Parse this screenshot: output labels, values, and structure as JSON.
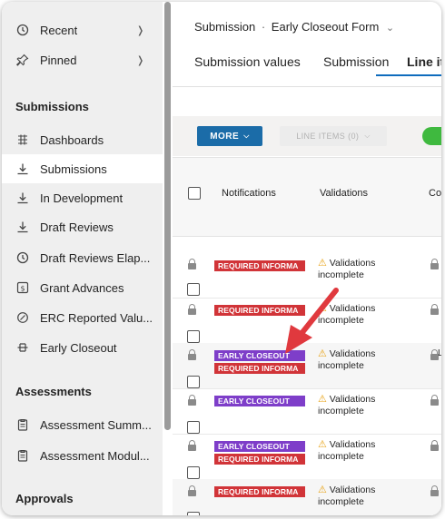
{
  "sidebar": {
    "top_items": [
      {
        "label": "Recent",
        "icon": "clock-icon"
      },
      {
        "label": "Pinned",
        "icon": "pin-icon"
      }
    ],
    "sections": [
      {
        "title": "Submissions",
        "items": [
          {
            "label": "Dashboards",
            "icon": "dashboard-icon"
          },
          {
            "label": "Submissions",
            "icon": "download-icon"
          },
          {
            "label": "In Development",
            "icon": "download-icon"
          },
          {
            "label": "Draft Reviews",
            "icon": "download-icon"
          },
          {
            "label": "Draft Reviews Elap...",
            "icon": "clock-icon"
          },
          {
            "label": "Grant Advances",
            "icon": "money-icon"
          },
          {
            "label": "ERC Reported Valu...",
            "icon": "link-icon"
          },
          {
            "label": "Early Closeout",
            "icon": "closeout-icon"
          }
        ]
      },
      {
        "title": "Assessments",
        "items": [
          {
            "label": "Assessment Summ...",
            "icon": "clipboard-icon"
          },
          {
            "label": "Assessment Modul...",
            "icon": "clipboard-icon"
          }
        ]
      },
      {
        "title": "Approvals",
        "items": []
      }
    ]
  },
  "header": {
    "breadcrumb": [
      "Submission",
      "Early Closeout Form"
    ]
  },
  "tabs": [
    {
      "label": "Submission values"
    },
    {
      "label": "Submission"
    },
    {
      "label": "Line it"
    }
  ],
  "toolbar": {
    "more_label": "MORE",
    "line_items_label": "LINE ITEMS (0)"
  },
  "grid": {
    "columns": [
      "Notifications",
      "Validations",
      "Cor"
    ],
    "rows": [
      {
        "badges": [
          {
            "text": "REQUIRED INFORMA",
            "color": "red"
          }
        ],
        "validation": [
          "Validations",
          "incomplete"
        ],
        "extra": ""
      },
      {
        "badges": [
          {
            "text": "REQUIRED INFORMA",
            "color": "red"
          }
        ],
        "validation": [
          "Validations",
          "incomplete"
        ],
        "extra": ""
      },
      {
        "badges": [
          {
            "text": "EARLY CLOSEOUT",
            "color": "purple"
          },
          {
            "text": "REQUIRED INFORMA",
            "color": "red"
          }
        ],
        "validation": [
          "Validations",
          "incomplete"
        ],
        "extra": "Le"
      },
      {
        "badges": [
          {
            "text": "EARLY CLOSEOUT",
            "color": "purple"
          }
        ],
        "validation": [
          "Validations",
          "incomplete"
        ],
        "extra": ""
      },
      {
        "badges": [
          {
            "text": "EARLY CLOSEOUT",
            "color": "purple"
          },
          {
            "text": "REQUIRED INFORMA",
            "color": "red"
          }
        ],
        "validation": [
          "Validations",
          "incomplete"
        ],
        "extra": ""
      },
      {
        "badges": [
          {
            "text": "REQUIRED INFORMA",
            "color": "red"
          }
        ],
        "validation": [
          "Validations",
          "incomplete"
        ],
        "extra": ""
      }
    ]
  },
  "colors": {
    "accent": "#0f6cbd",
    "badge_red": "#d13438",
    "badge_purple": "#7e3ec9",
    "toggle_on": "#3fb93f",
    "annotation_arrow": "#e0393e"
  }
}
